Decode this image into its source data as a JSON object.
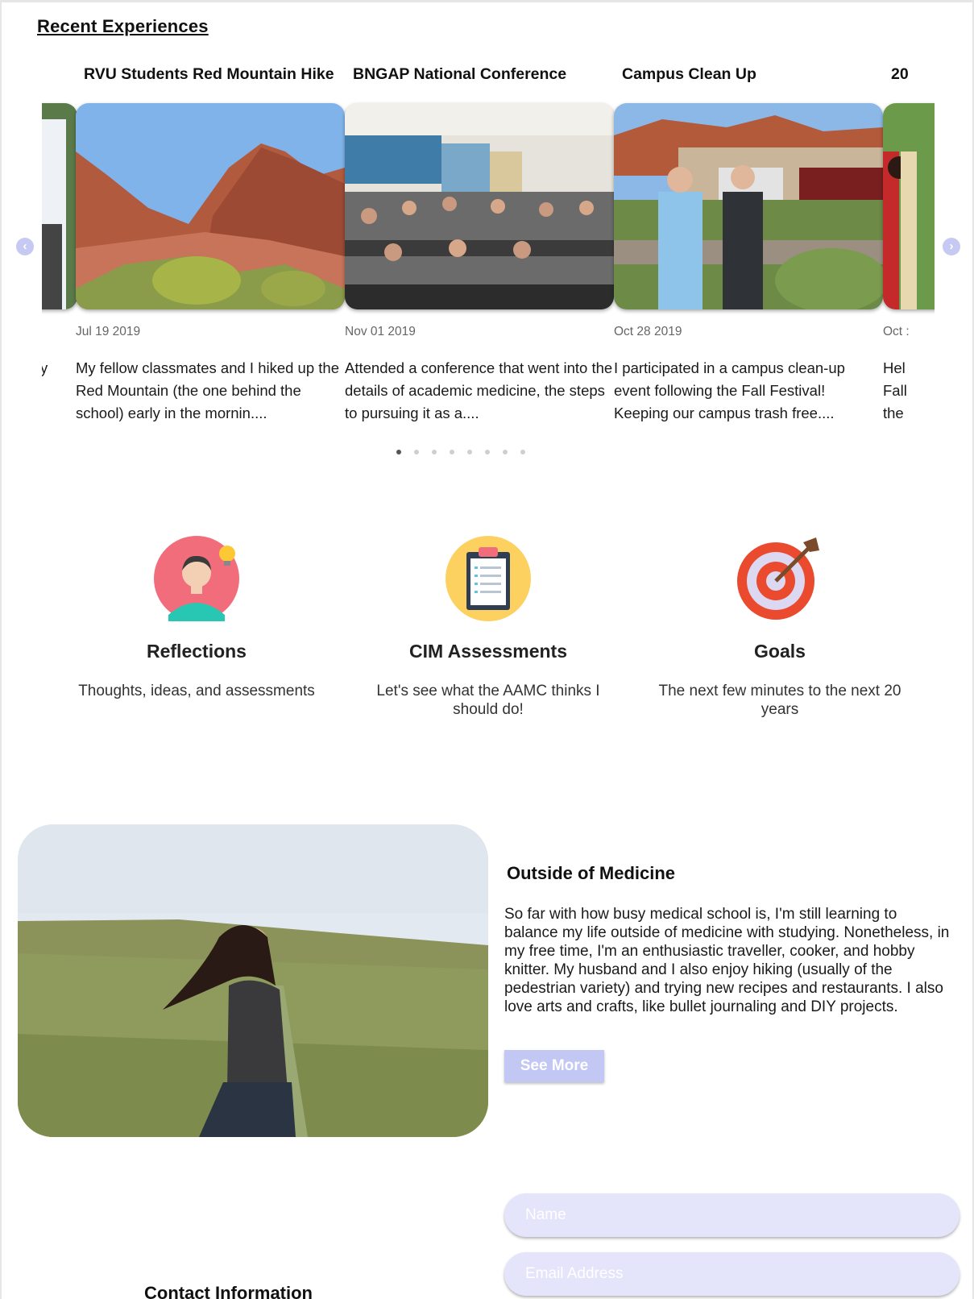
{
  "section": {
    "title": "Recent Experiences"
  },
  "carousel": {
    "prev_icon": "chevron-left-icon",
    "next_icon": "chevron-right-icon",
    "partial_left_text": "y",
    "slides": [
      {
        "title": "RVU Students Red Mountain Hike",
        "date": "Jul 19 2019",
        "text": "My fellow classmates and I hiked up the Red Mountain (the one behind the school) early in the mornin...."
      },
      {
        "title": "BNGAP National Conference",
        "date": "Nov 01 2019",
        "text": "Attended a conference that went into the details of academic medicine, the steps to pursuing it as a...."
      },
      {
        "title": "Campus Clean Up",
        "date": "Oct 28 2019",
        "text": "I participated in a campus clean-up event following the Fall Festival! Keeping our campus trash free...."
      },
      {
        "title": "20",
        "date": "Oct :",
        "text": "Hel\nFall\nthe"
      }
    ],
    "dot_count": 8,
    "active_dot": 0
  },
  "features": [
    {
      "icon": "person-lightbulb-icon",
      "title": "Reflections",
      "text": "Thoughts, ideas, and assessments"
    },
    {
      "icon": "clipboard-icon",
      "title": "CIM Assessments",
      "text": "Let's see what the AAMC thinks I should do!"
    },
    {
      "icon": "target-arrow-icon",
      "title": "Goals",
      "text": "The next few minutes to the next 20 years"
    }
  ],
  "outside": {
    "title": "Outside of Medicine",
    "text": "So far with how busy medical school is, I'm still learning to balance my life outside of medicine with studying. Nonetheless, in my free time, I'm an enthusiastic traveller, cooker, and hobby knitter. My husband and I also enjoy hiking (usually of the pedestrian variety) and trying new recipes and restaurants. I also love arts and crafts, like bullet journaling and DIY projects.",
    "button": "See More"
  },
  "contact": {
    "title": "Contact Information",
    "name_placeholder": "Name",
    "email_placeholder": "Email Address"
  },
  "colors": {
    "accent": "#c3c7f3",
    "field_bg": "#e4e4fb"
  }
}
